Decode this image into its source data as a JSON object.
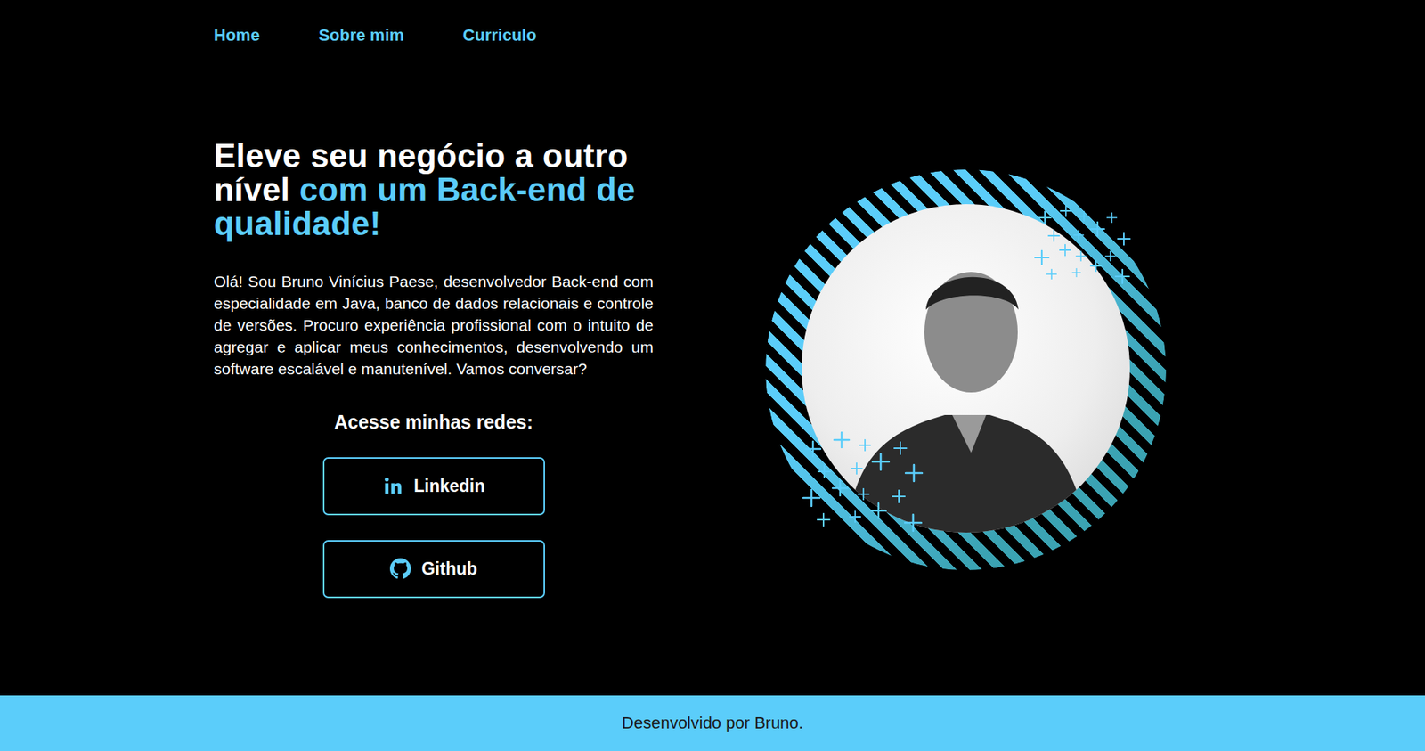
{
  "nav": [
    {
      "label": "Home"
    },
    {
      "label": "Sobre mim"
    },
    {
      "label": "Curriculo"
    }
  ],
  "heading": [
    {
      "text": "Eleve seu negócio a outro nível ",
      "color": "#ffffff"
    },
    {
      "text": "com um Back-end de qualidade!",
      "color": "#5bcdfa"
    }
  ],
  "intro": "Olá! Sou Bruno Vinícius Paese, desenvolvedor Back-end com especialidade em Java, banco de dados relacionais e controle de versões. Procuro experiência profissional com o intuito de agregar e aplicar meus conhecimentos, desenvolvendo um software escalável e manutenível. Vamos conversar?",
  "social_title": "Acesse minhas redes:",
  "social_buttons": [
    {
      "label": "Linkedin",
      "kind": "linkedin"
    },
    {
      "label": "Github",
      "kind": "github"
    }
  ],
  "footer": "Desenvolvido por Bruno."
}
